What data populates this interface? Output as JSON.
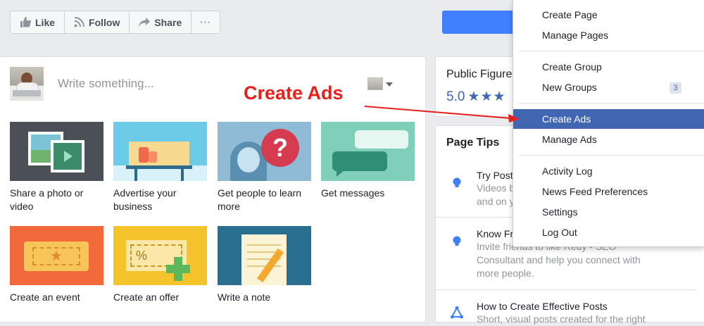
{
  "actions": {
    "like": "Like",
    "follow": "Follow",
    "share": "Share",
    "more": "···"
  },
  "composer": {
    "placeholder": "Write something...",
    "tiles": [
      {
        "label": "Share a photo or video"
      },
      {
        "label": "Advertise your business"
      },
      {
        "label": "Get people to learn more"
      },
      {
        "label": "Get messages"
      },
      {
        "label": "Create an event"
      },
      {
        "label": "Create an offer"
      },
      {
        "label": "Write a note"
      }
    ]
  },
  "public_card": {
    "title": "Public Figure",
    "rating": "5.0",
    "stars": "★★★"
  },
  "tips": {
    "heading": "Page Tips",
    "items": [
      {
        "title": "Try Post",
        "desc1": "Videos b",
        "desc2": "and on y"
      },
      {
        "title": "Know Fr",
        "desc1": "Invite friends to like Redy - SEO",
        "desc2": "Consultant and help you connect with",
        "desc3": "more people."
      },
      {
        "title": "How to Create Effective Posts",
        "desc1": "Short, visual posts created for the right"
      }
    ]
  },
  "menu": {
    "items": [
      {
        "label": "Create Page"
      },
      {
        "label": "Manage Pages"
      },
      {
        "label": "Create Group"
      },
      {
        "label": "New Groups",
        "badge": "3"
      },
      {
        "label": "Create Ads"
      },
      {
        "label": "Manage Ads"
      },
      {
        "label": "Activity Log"
      },
      {
        "label": "News Feed Preferences"
      },
      {
        "label": "Settings"
      },
      {
        "label": "Log Out"
      }
    ]
  },
  "annotation": {
    "text": "Create Ads",
    "color": "#e8201b"
  },
  "colors": {
    "accent": "#4267b2",
    "primary_button": "#4080ff"
  }
}
